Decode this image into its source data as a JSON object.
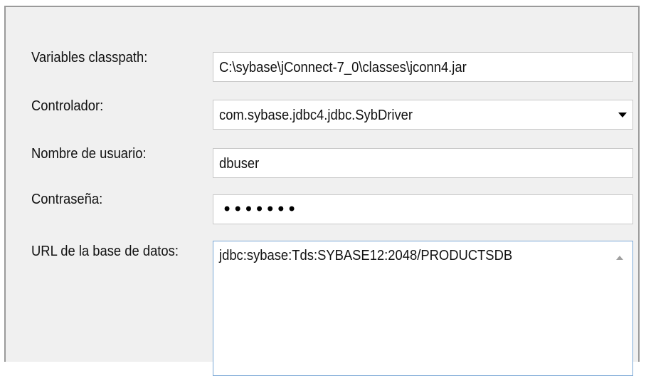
{
  "form": {
    "classpath": {
      "label": "Variables classpath:",
      "value": "C:\\sybase\\jConnect-7_0\\classes\\jconn4.jar"
    },
    "driver": {
      "label": "Controlador:",
      "value": "com.sybase.jdbc4.jdbc.SybDriver"
    },
    "username": {
      "label": "Nombre de usuario:",
      "value": "dbuser"
    },
    "password": {
      "label": "Contraseña:",
      "value": "•••••••"
    },
    "database_url": {
      "label": "URL de la base de datos:",
      "value": "jdbc:sybase:Tds:SYBASE12:2048/PRODUCTSDB"
    }
  },
  "icons": {
    "dropdown": "chevron-down-icon",
    "scroll_up": "scroll-up-icon"
  },
  "colors": {
    "panel_bg": "#f0f0f0",
    "field_bg": "#ffffff",
    "focus_border": "#7aa7d6"
  }
}
